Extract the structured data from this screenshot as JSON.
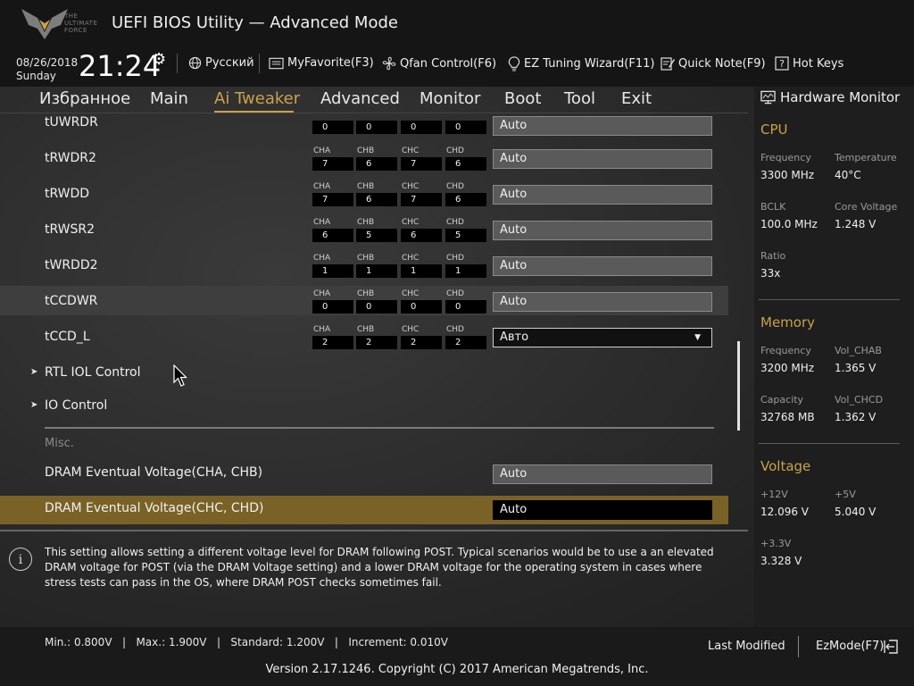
{
  "header": {
    "logo_text": "THE ULTIMATE FORCE",
    "title": "UEFI BIOS Utility — Advanced Mode",
    "date": "08/26/2018",
    "day": "Sunday",
    "time": "21:24",
    "tools": {
      "language": "Русский",
      "myfavorite": "MyFavorite(F3)",
      "qfan": "Qfan Control(F6)",
      "ez_tuning": "EZ Tuning Wizard(F11)",
      "quick_note": "Quick Note(F9)",
      "hot_keys": "Hot Keys"
    }
  },
  "tabs": [
    "Избранное",
    "Main",
    "Ai Tweaker",
    "Advanced",
    "Monitor",
    "Boot",
    "Tool",
    "Exit"
  ],
  "active_tab": "Ai Tweaker",
  "channel_labels": [
    "CHA",
    "CHB",
    "CHC",
    "CHD"
  ],
  "rows": [
    {
      "label": "tUWRDR",
      "channels": [
        "0",
        "0",
        "0",
        "0"
      ],
      "value": "Auto"
    },
    {
      "label": "tRWDR2",
      "channels": [
        "7",
        "6",
        "7",
        "6"
      ],
      "value": "Auto"
    },
    {
      "label": "tRWDD",
      "channels": [
        "7",
        "6",
        "7",
        "6"
      ],
      "value": "Auto"
    },
    {
      "label": "tRWSR2",
      "channels": [
        "6",
        "5",
        "6",
        "5"
      ],
      "value": "Auto"
    },
    {
      "label": "tWRDD2",
      "channels": [
        "1",
        "1",
        "1",
        "1"
      ],
      "value": "Auto"
    },
    {
      "label": "tCCDWR",
      "channels": [
        "0",
        "0",
        "0",
        "0"
      ],
      "value": "Auto"
    },
    {
      "label": "tCCD_L",
      "channels": [
        "2",
        "2",
        "2",
        "2"
      ],
      "value": "Авто"
    }
  ],
  "submenus": [
    "RTL IOL Control",
    "IO Control"
  ],
  "misc_heading": "Misc.",
  "voltage_rows": [
    {
      "label": "DRAM Eventual Voltage(CHA, CHB)",
      "value": "Auto"
    },
    {
      "label": "DRAM Eventual Voltage(CHC, CHD)",
      "value": "Auto"
    }
  ],
  "help_text": "This setting allows setting a different voltage level for DRAM following POST. Typical scenarios would be to use a an elevated DRAM voltage for POST (via the DRAM Voltage setting) and a lower DRAM voltage for the operating system in cases where stress tests can pass in the OS, where DRAM POST checks sometimes fail.",
  "hardware_monitor": {
    "title": "Hardware Monitor",
    "cpu": {
      "heading": "CPU",
      "frequency_label": "Frequency",
      "frequency": "3300 MHz",
      "temperature_label": "Temperature",
      "temperature": "40°C",
      "bclk_label": "BCLK",
      "bclk": "100.0 MHz",
      "core_voltage_label": "Core Voltage",
      "core_voltage": "1.248 V",
      "ratio_label": "Ratio",
      "ratio": "33x"
    },
    "memory": {
      "heading": "Memory",
      "frequency_label": "Frequency",
      "frequency": "3200 MHz",
      "vol_chab_label": "Vol_CHAB",
      "vol_chab": "1.365 V",
      "capacity_label": "Capacity",
      "capacity": "32768 MB",
      "vol_chcd_label": "Vol_CHCD",
      "vol_chcd": "1.362 V"
    },
    "voltage": {
      "heading": "Voltage",
      "v12_label": "+12V",
      "v12": "12.096 V",
      "v5_label": "+5V",
      "v5": "5.040 V",
      "v33_label": "+3.3V",
      "v33": "3.328 V"
    }
  },
  "footer": {
    "info": "Min.: 0.800V   |   Max.: 1.900V   |   Standard: 1.200V   |   Increment: 0.010V",
    "last_modified": "Last Modified",
    "ezmode": "EzMode(F7)",
    "copyright": "Version 2.17.1246. Copyright (C) 2017 American Megatrends, Inc."
  },
  "colors": {
    "accent": "#c9a24a",
    "selected_row": "#7a6226"
  }
}
